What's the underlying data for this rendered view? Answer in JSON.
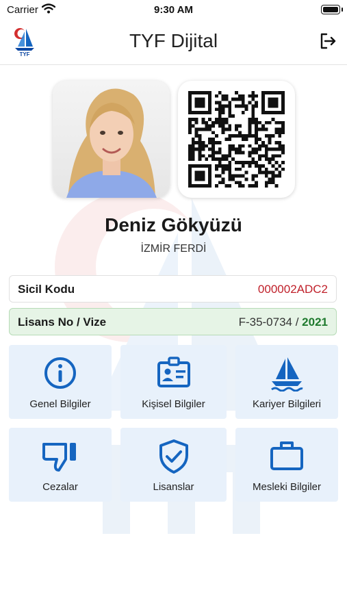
{
  "status_bar": {
    "carrier": "Carrier",
    "time": "9:30 AM"
  },
  "header": {
    "title": "TYF Dijital",
    "logo_text": "TYF",
    "logout_icon": "logout-icon"
  },
  "profile": {
    "name": "Deniz Gökyüzü",
    "club": "İZMİR FERDİ"
  },
  "info": {
    "sicil_label": "Sicil Kodu",
    "sicil_value": "000002ADC2",
    "lisans_label": "Lisans No / Vize",
    "lisans_value": "F-35-0734",
    "lisans_sep": " / ",
    "vize_year": "2021"
  },
  "tiles": [
    {
      "label": "Genel Bilgiler",
      "icon": "info-circle-icon"
    },
    {
      "label": "Kişisel Bilgiler",
      "icon": "id-badge-icon"
    },
    {
      "label": "Kariyer Bilgileri",
      "icon": "sailboat-icon"
    },
    {
      "label": "Cezalar",
      "icon": "thumbs-down-icon"
    },
    {
      "label": "Lisanslar",
      "icon": "shield-check-icon"
    },
    {
      "label": "Mesleki Bilgiler",
      "icon": "briefcase-icon"
    }
  ],
  "colors": {
    "accent_blue": "#1565c0",
    "tile_bg": "#e8f1fb",
    "sicil_value": "#c0202a",
    "lisans_bg": "#e6f4e6",
    "vize_green": "#1f7a2e"
  }
}
